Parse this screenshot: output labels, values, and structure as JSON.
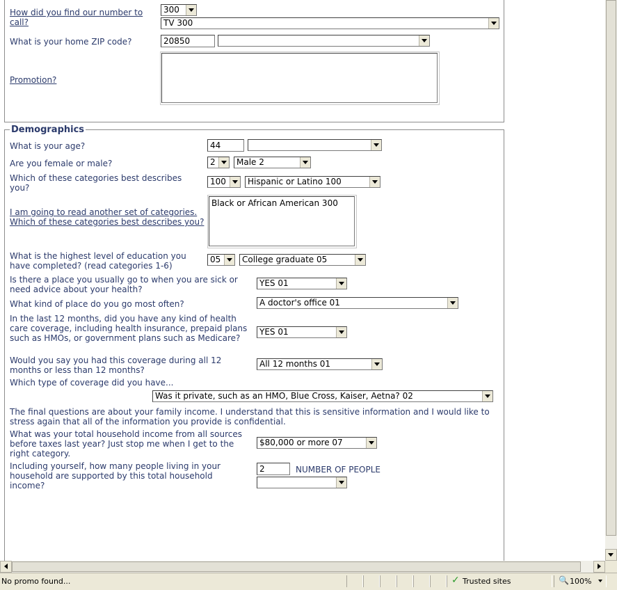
{
  "top": {
    "find_number_label": "How did you find our number to call?",
    "find_number_code": "300",
    "find_number_value": "TV 300",
    "zip_label": "What is your home ZIP code?",
    "zip_value": "20850",
    "zip_select": "",
    "promotion_label": "Promotion?",
    "promotion_value": ""
  },
  "demographics": {
    "legend": "Demographics",
    "age_label": "What is your age?",
    "age_value": "44",
    "age_select": "",
    "sex_label": "Are you female or male?",
    "sex_code": "2",
    "sex_value": "Male  2",
    "race_label": "Which of these categories best describes you?",
    "race_code": "100",
    "race_value": "Hispanic or Latino  100",
    "race2_label": "I am going to read another set of categories.  Which of these categories best describes you?",
    "race2_value": "Black or African American  300",
    "edu_label": "What is the highest level of education you have completed? (read categories 1-6)",
    "edu_code": "05",
    "edu_value": "College graduate  05",
    "place_label": "Is there a place you usually go to when you are sick or need advice about your health?",
    "place_value": "YES  01",
    "kind_label": "What kind of place do you go most often?",
    "kind_value": "A doctor's office  01",
    "coverage_label": "In the last 12 months, did you have any kind of health care coverage, including health insurance, prepaid plans such as HMOs, or government plans such as Medicare?",
    "coverage_value": "YES  01",
    "months_label": "Would you say you had this coverage during all 12 months or less than 12 months?",
    "months_value": "All 12 months  01",
    "type_label": "Which type of coverage did you have...",
    "type_value": "Was it private, such as an HMO, Blue Cross, Kaiser, Aetna?  02",
    "final_text": "The final questions are about your family income. I understand that this is sensitive information and I would like to stress again that all of the information you provide is confidential.",
    "income_label": "What was your total household income from all sources before taxes last year?  Just stop me when I get to the right category.",
    "income_value": "$80,000 or more  07",
    "people_label": "Including yourself, how many people living in your household are supported by this total household income?",
    "people_value": "2",
    "people_unit": "NUMBER OF PEOPLE",
    "people_select": ""
  },
  "status": {
    "message": "No promo found...",
    "zone": "Trusted sites",
    "zoom": "100%",
    "check_icon": "check-icon",
    "zoom_icon": "magnifier-icon"
  }
}
